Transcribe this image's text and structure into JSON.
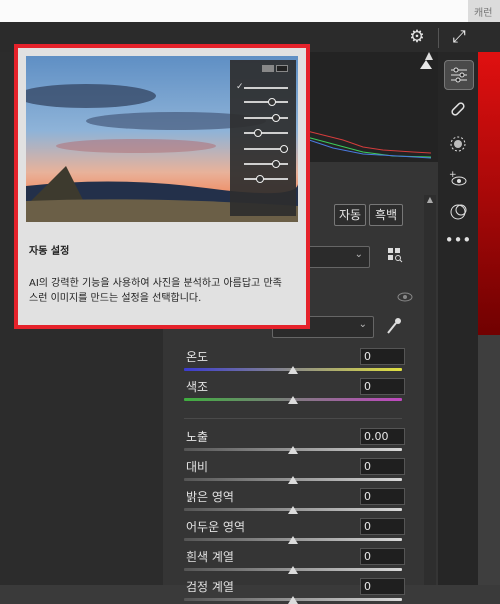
{
  "topbar": {
    "right_text": "캐런"
  },
  "panel": {
    "auto_label": "자동",
    "bw_label": "흑백",
    "white_balance_value": "",
    "sliders": [
      {
        "label": "온도",
        "value": "0",
        "pos": 0.5,
        "colors": [
          "#3b3bd0",
          "#e0e040"
        ]
      },
      {
        "label": "색조",
        "value": "0",
        "pos": 0.5,
        "colors": [
          "#3fae3f",
          "#c048c0"
        ]
      },
      {
        "label": "노출",
        "value": "0.00",
        "pos": 0.5,
        "colors": [
          "#555555",
          "#d8d8d8"
        ]
      },
      {
        "label": "대비",
        "value": "0",
        "pos": 0.5,
        "colors": [
          "#555555",
          "#d8d8d8"
        ]
      },
      {
        "label": "밝은 영역",
        "value": "0",
        "pos": 0.5,
        "colors": [
          "#555555",
          "#d8d8d8"
        ]
      },
      {
        "label": "어두운 영역",
        "value": "0",
        "pos": 0.5,
        "colors": [
          "#555555",
          "#d8d8d8"
        ]
      },
      {
        "label": "흰색 계열",
        "value": "0",
        "pos": 0.5,
        "colors": [
          "#555555",
          "#d8d8d8"
        ]
      },
      {
        "label": "검정 계열",
        "value": "0",
        "pos": 0.5,
        "colors": [
          "#555555",
          "#d8d8d8"
        ]
      }
    ]
  },
  "popover": {
    "title": "자동 설정",
    "description": "AI의 강력한 기능을 사용하여 사진을 분석하고 아름답고 만족스런 이미지를 만드는 설정을 선택합니다."
  },
  "icons": {
    "gear": "gear-icon",
    "expand": "expand-icon",
    "edit": "sliders-icon",
    "heal": "bandage-icon",
    "mask": "mask-icon",
    "redeye": "redeye-icon",
    "presets": "presets-icon",
    "more": "more-icon"
  }
}
